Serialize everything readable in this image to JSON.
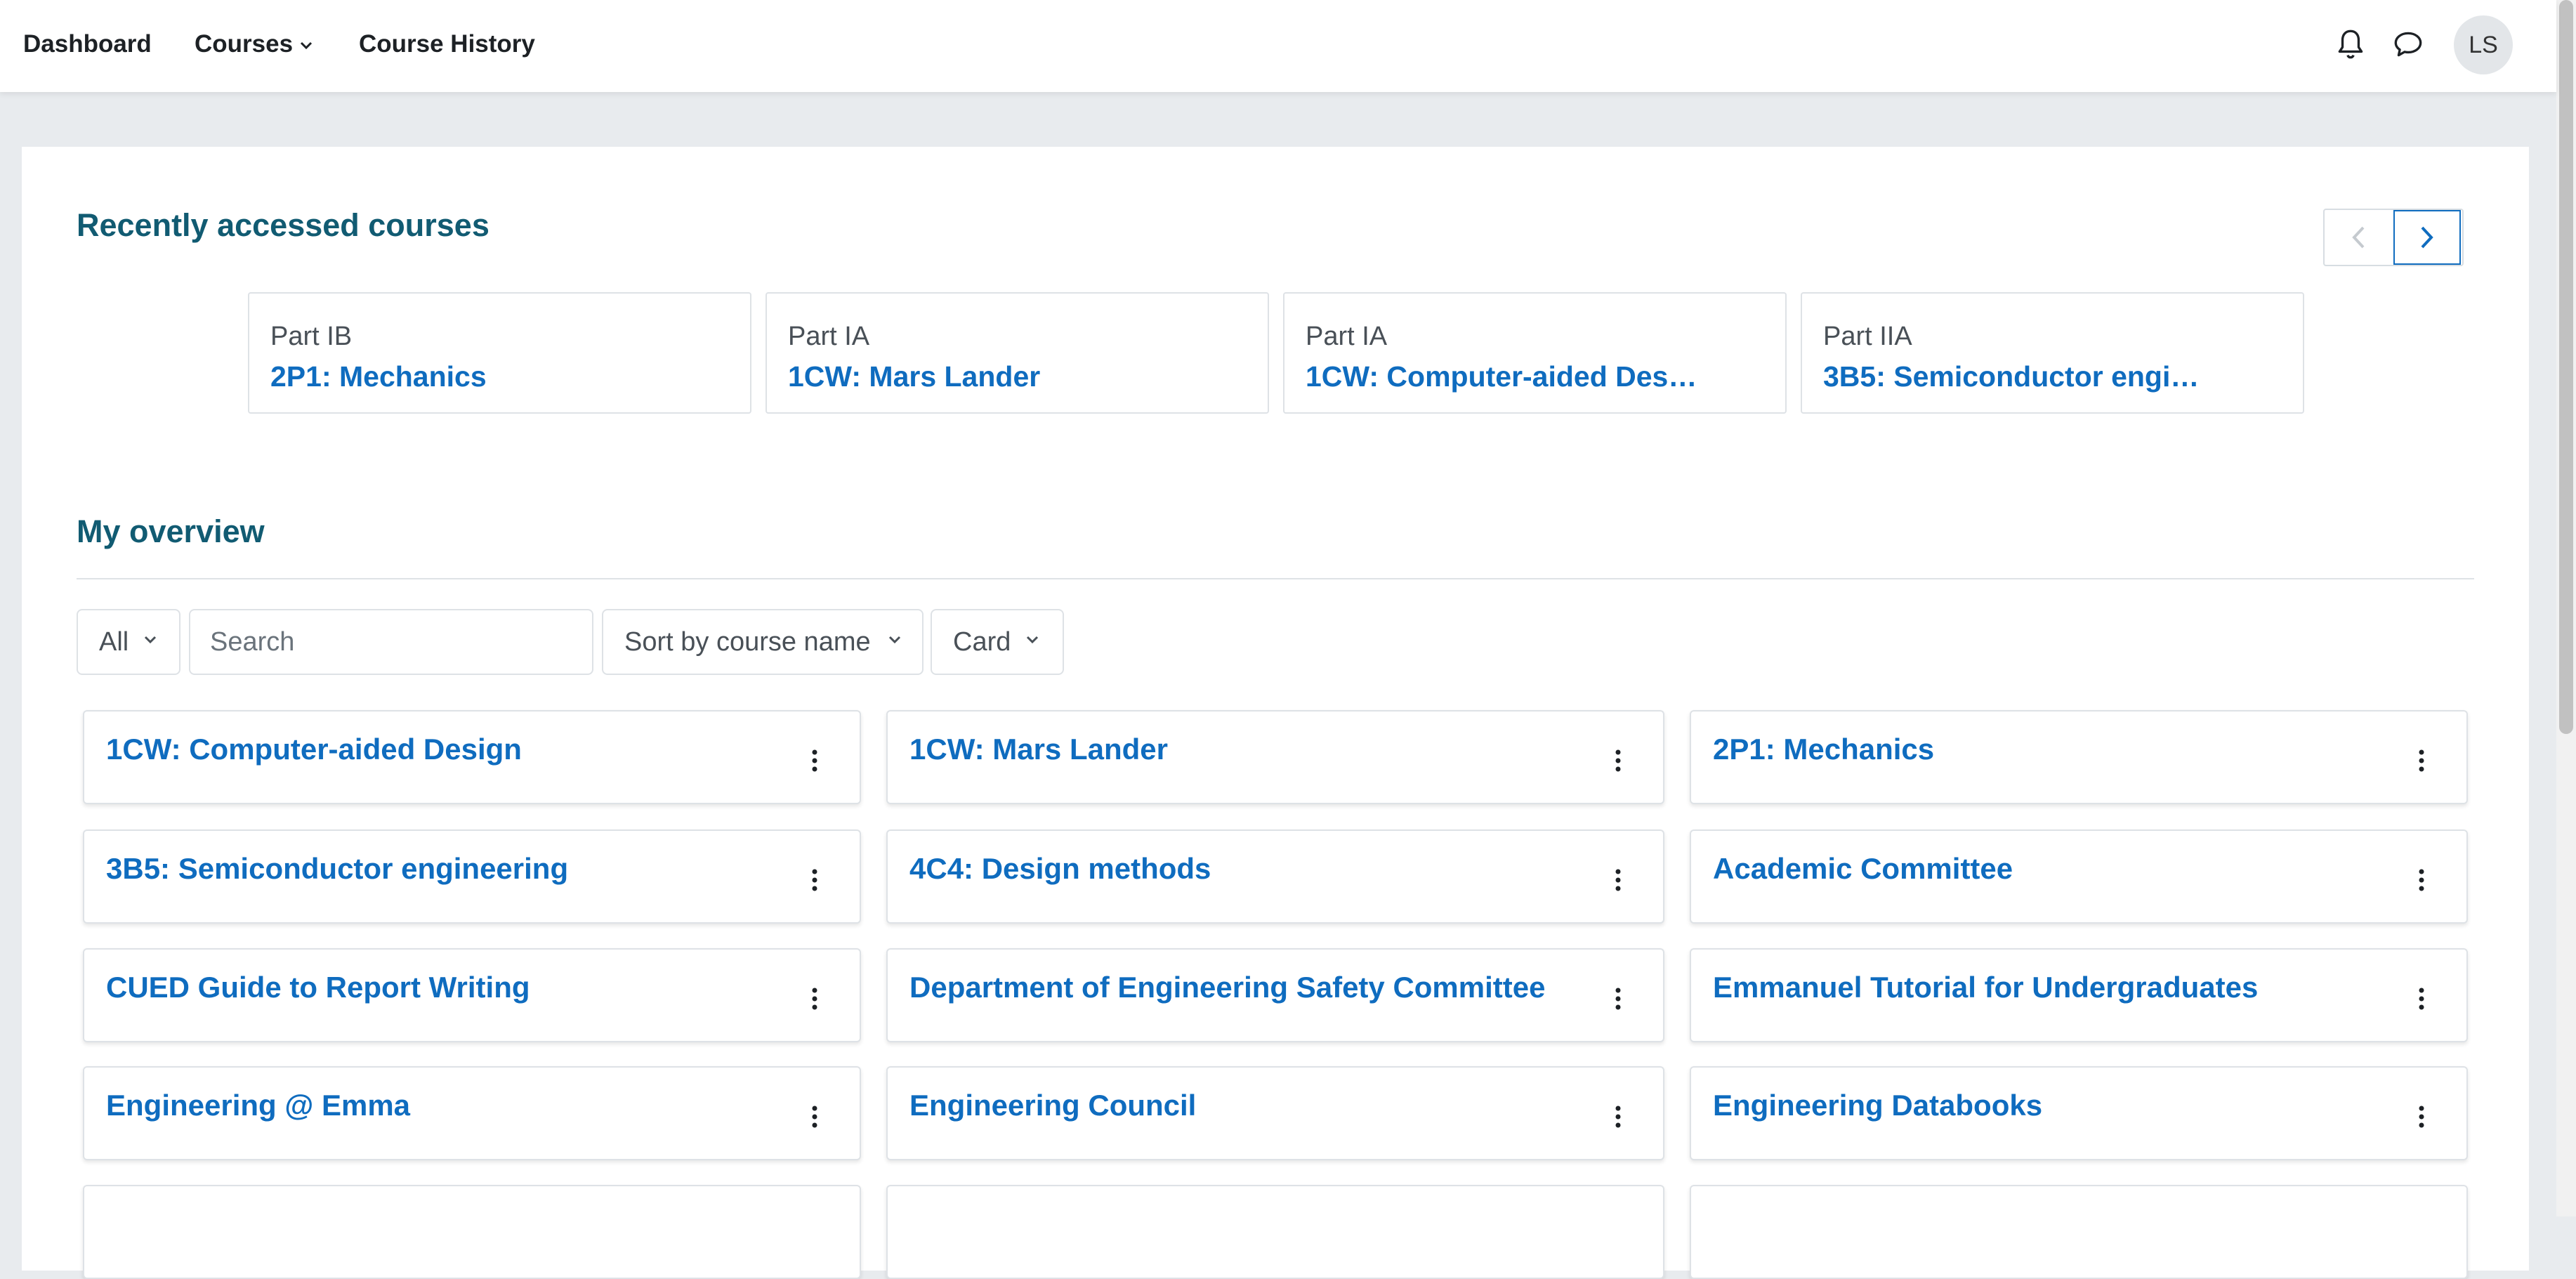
{
  "nav": {
    "items": [
      {
        "label": "Dashboard"
      },
      {
        "label": "Courses",
        "has_dropdown": true
      },
      {
        "label": "Course History"
      }
    ],
    "icons": [
      "bell-icon",
      "chat-icon"
    ],
    "avatar_initials": "LS"
  },
  "recent": {
    "title": "Recently accessed courses",
    "courses": [
      {
        "category": "Part IB",
        "name": "2P1: Mechanics"
      },
      {
        "category": "Part IA",
        "name": "1CW: Mars Lander"
      },
      {
        "category": "Part IA",
        "name": "1CW: Computer-aided Des…"
      },
      {
        "category": "Part IIA",
        "name": "3B5: Semiconductor engi…"
      }
    ]
  },
  "overview": {
    "title": "My overview",
    "filters": {
      "grouping": "All",
      "search_placeholder": "Search",
      "sort": "Sort by course name",
      "view": "Card"
    },
    "courses": [
      "1CW: Computer-aided Design",
      "1CW: Mars Lander",
      "2P1: Mechanics",
      "3B5: Semiconductor engineering",
      "4C4: Design methods",
      "Academic Committee",
      "CUED Guide to Report Writing",
      "Department of Engineering Safety Committee",
      "Emmanuel Tutorial for Undergraduates",
      "Engineering @ Emma",
      "Engineering Council",
      "Engineering Databooks"
    ]
  },
  "colors": {
    "link": "#0f6cbf",
    "heading": "#115b72",
    "page_bg": "#e8ebee"
  }
}
